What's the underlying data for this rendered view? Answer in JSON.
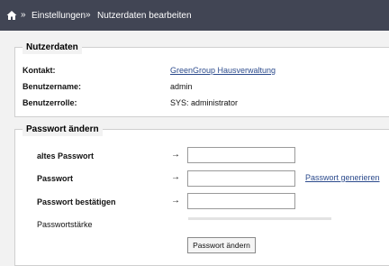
{
  "breadcrumb": {
    "items": [
      "Einstellungen",
      "Nutzerdaten bearbeiten"
    ],
    "separator": "»"
  },
  "user_data": {
    "legend": "Nutzerdaten",
    "rows": [
      {
        "label": "Kontakt:",
        "value": "GreenGroup Hausverwaltung"
      },
      {
        "label": "Benutzername:",
        "value": "admin"
      },
      {
        "label": "Benutzerrolle:",
        "value": "SYS: administrator"
      }
    ]
  },
  "password": {
    "legend": "Passwort ändern",
    "arrow": "→",
    "old_label": "altes Passwort",
    "new_label": "Passwort",
    "confirm_label": "Passwort bestätigen",
    "generate_link": "Passwort generieren",
    "strength_label": "Passwortstärke",
    "submit_label": "Passwort ändern",
    "old_value": "",
    "new_value": "",
    "confirm_value": ""
  },
  "colors": {
    "topbar": "#414554",
    "link": "#2b4a8c",
    "background": "#f2f2f2"
  },
  "icons": {
    "home": "home-icon"
  }
}
